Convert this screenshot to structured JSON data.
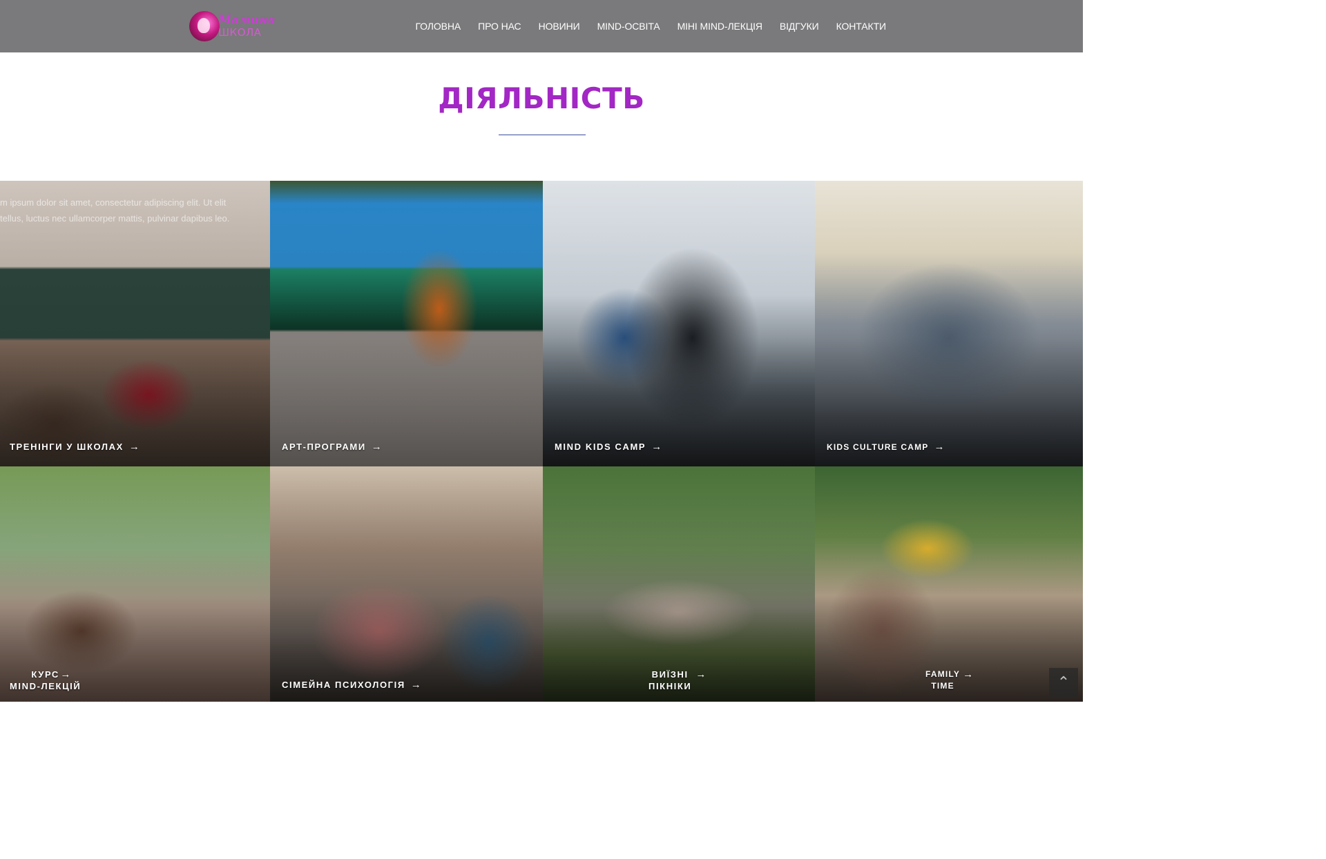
{
  "header": {
    "logo": {
      "line1": "Мамина",
      "line2": "ШКОЛА"
    },
    "nav": [
      {
        "label": "ГОЛОВНА"
      },
      {
        "label": "ПРО НАС"
      },
      {
        "label": "НОВИНИ"
      },
      {
        "label": "MIND-ОСВІТА"
      },
      {
        "label": "МІНІ MIND-ЛЕКЦІЯ"
      },
      {
        "label": "ВІДГУКИ"
      },
      {
        "label": "КОНТАКТИ"
      }
    ]
  },
  "section": {
    "title": "ДІЯЛЬНІСТЬ",
    "overlay_text_line1": "m ipsum dolor sit amet, consectetur adipiscing elit. Ut elit",
    "overlay_text_line2": "tellus, luctus nec ullamcorper mattis, pulvinar dapibus leo."
  },
  "tiles": [
    {
      "label": "ТРЕНІНГИ У ШКОЛАХ"
    },
    {
      "label": "АРТ-ПРОГРАМИ"
    },
    {
      "label": "MIND KIDS CAMP"
    },
    {
      "label": "KIDS CULTURE CAMP"
    },
    {
      "label": "КУРС\nMIND-ЛЕКЦІЙ"
    },
    {
      "label": "СІМЕЙНА ПСИХОЛОГІЯ"
    },
    {
      "label": "ВИЇЗНІ\nПІКНІКИ"
    },
    {
      "label": "FAMILY\nTIME"
    }
  ],
  "icons": {
    "arrow": "→",
    "scroll_top": "⌃"
  }
}
